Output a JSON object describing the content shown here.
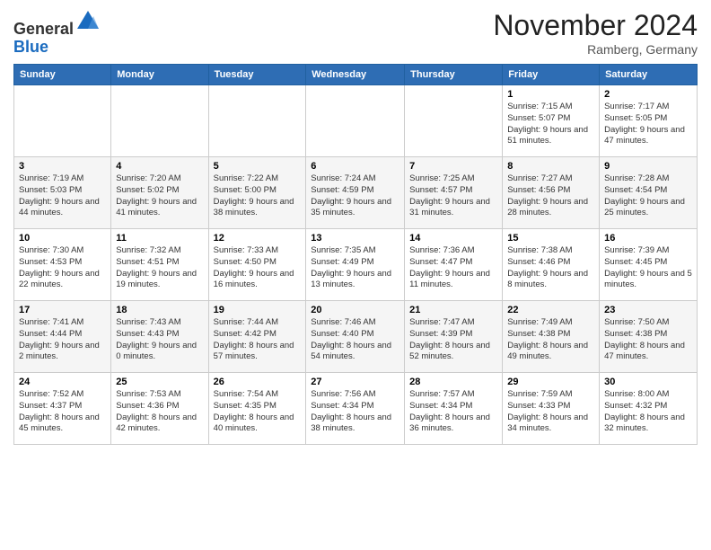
{
  "logo": {
    "line1": "General",
    "line2": "Blue"
  },
  "title": "November 2024",
  "location": "Ramberg, Germany",
  "days_of_week": [
    "Sunday",
    "Monday",
    "Tuesday",
    "Wednesday",
    "Thursday",
    "Friday",
    "Saturday"
  ],
  "weeks": [
    [
      {
        "day": "",
        "info": ""
      },
      {
        "day": "",
        "info": ""
      },
      {
        "day": "",
        "info": ""
      },
      {
        "day": "",
        "info": ""
      },
      {
        "day": "",
        "info": ""
      },
      {
        "day": "1",
        "info": "Sunrise: 7:15 AM\nSunset: 5:07 PM\nDaylight: 9 hours and 51 minutes."
      },
      {
        "day": "2",
        "info": "Sunrise: 7:17 AM\nSunset: 5:05 PM\nDaylight: 9 hours and 47 minutes."
      }
    ],
    [
      {
        "day": "3",
        "info": "Sunrise: 7:19 AM\nSunset: 5:03 PM\nDaylight: 9 hours and 44 minutes."
      },
      {
        "day": "4",
        "info": "Sunrise: 7:20 AM\nSunset: 5:02 PM\nDaylight: 9 hours and 41 minutes."
      },
      {
        "day": "5",
        "info": "Sunrise: 7:22 AM\nSunset: 5:00 PM\nDaylight: 9 hours and 38 minutes."
      },
      {
        "day": "6",
        "info": "Sunrise: 7:24 AM\nSunset: 4:59 PM\nDaylight: 9 hours and 35 minutes."
      },
      {
        "day": "7",
        "info": "Sunrise: 7:25 AM\nSunset: 4:57 PM\nDaylight: 9 hours and 31 minutes."
      },
      {
        "day": "8",
        "info": "Sunrise: 7:27 AM\nSunset: 4:56 PM\nDaylight: 9 hours and 28 minutes."
      },
      {
        "day": "9",
        "info": "Sunrise: 7:28 AM\nSunset: 4:54 PM\nDaylight: 9 hours and 25 minutes."
      }
    ],
    [
      {
        "day": "10",
        "info": "Sunrise: 7:30 AM\nSunset: 4:53 PM\nDaylight: 9 hours and 22 minutes."
      },
      {
        "day": "11",
        "info": "Sunrise: 7:32 AM\nSunset: 4:51 PM\nDaylight: 9 hours and 19 minutes."
      },
      {
        "day": "12",
        "info": "Sunrise: 7:33 AM\nSunset: 4:50 PM\nDaylight: 9 hours and 16 minutes."
      },
      {
        "day": "13",
        "info": "Sunrise: 7:35 AM\nSunset: 4:49 PM\nDaylight: 9 hours and 13 minutes."
      },
      {
        "day": "14",
        "info": "Sunrise: 7:36 AM\nSunset: 4:47 PM\nDaylight: 9 hours and 11 minutes."
      },
      {
        "day": "15",
        "info": "Sunrise: 7:38 AM\nSunset: 4:46 PM\nDaylight: 9 hours and 8 minutes."
      },
      {
        "day": "16",
        "info": "Sunrise: 7:39 AM\nSunset: 4:45 PM\nDaylight: 9 hours and 5 minutes."
      }
    ],
    [
      {
        "day": "17",
        "info": "Sunrise: 7:41 AM\nSunset: 4:44 PM\nDaylight: 9 hours and 2 minutes."
      },
      {
        "day": "18",
        "info": "Sunrise: 7:43 AM\nSunset: 4:43 PM\nDaylight: 9 hours and 0 minutes."
      },
      {
        "day": "19",
        "info": "Sunrise: 7:44 AM\nSunset: 4:42 PM\nDaylight: 8 hours and 57 minutes."
      },
      {
        "day": "20",
        "info": "Sunrise: 7:46 AM\nSunset: 4:40 PM\nDaylight: 8 hours and 54 minutes."
      },
      {
        "day": "21",
        "info": "Sunrise: 7:47 AM\nSunset: 4:39 PM\nDaylight: 8 hours and 52 minutes."
      },
      {
        "day": "22",
        "info": "Sunrise: 7:49 AM\nSunset: 4:38 PM\nDaylight: 8 hours and 49 minutes."
      },
      {
        "day": "23",
        "info": "Sunrise: 7:50 AM\nSunset: 4:38 PM\nDaylight: 8 hours and 47 minutes."
      }
    ],
    [
      {
        "day": "24",
        "info": "Sunrise: 7:52 AM\nSunset: 4:37 PM\nDaylight: 8 hours and 45 minutes."
      },
      {
        "day": "25",
        "info": "Sunrise: 7:53 AM\nSunset: 4:36 PM\nDaylight: 8 hours and 42 minutes."
      },
      {
        "day": "26",
        "info": "Sunrise: 7:54 AM\nSunset: 4:35 PM\nDaylight: 8 hours and 40 minutes."
      },
      {
        "day": "27",
        "info": "Sunrise: 7:56 AM\nSunset: 4:34 PM\nDaylight: 8 hours and 38 minutes."
      },
      {
        "day": "28",
        "info": "Sunrise: 7:57 AM\nSunset: 4:34 PM\nDaylight: 8 hours and 36 minutes."
      },
      {
        "day": "29",
        "info": "Sunrise: 7:59 AM\nSunset: 4:33 PM\nDaylight: 8 hours and 34 minutes."
      },
      {
        "day": "30",
        "info": "Sunrise: 8:00 AM\nSunset: 4:32 PM\nDaylight: 8 hours and 32 minutes."
      }
    ]
  ]
}
